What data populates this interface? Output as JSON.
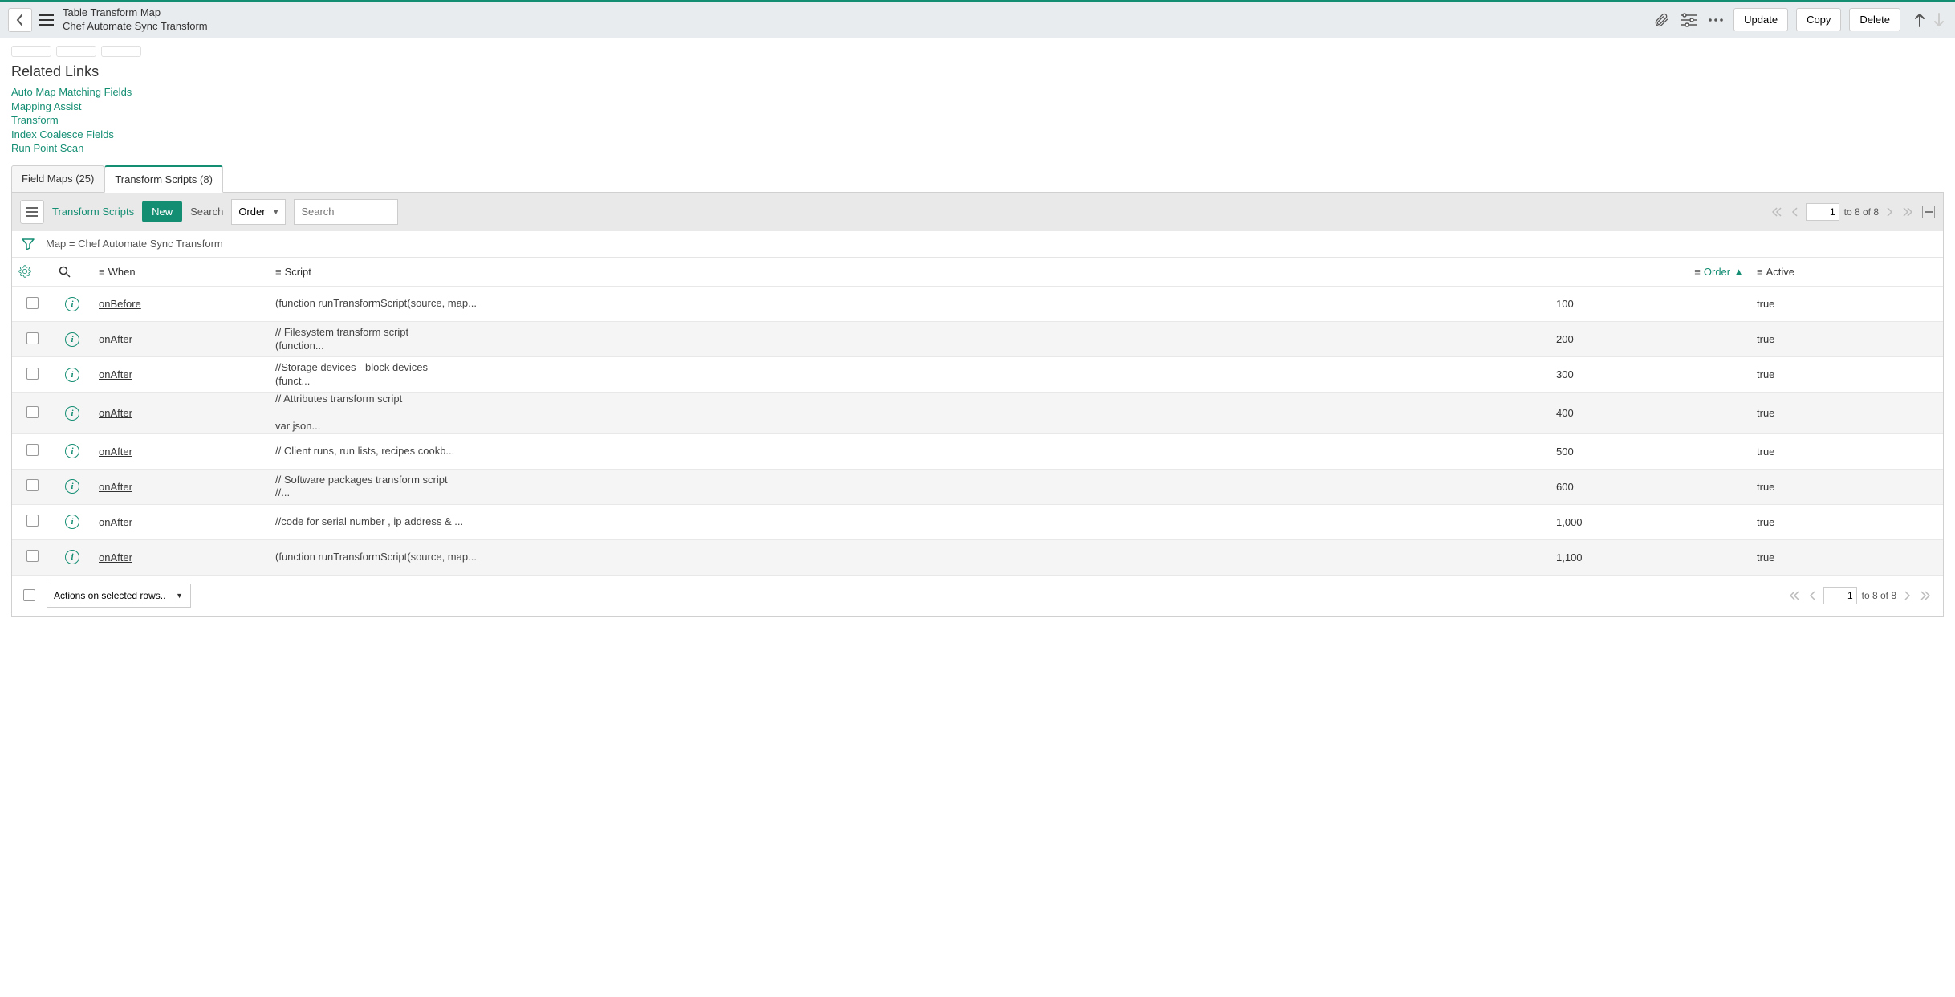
{
  "header": {
    "title": "Table Transform Map",
    "subtitle": "Chef Automate Sync Transform",
    "update_label": "Update",
    "copy_label": "Copy",
    "delete_label": "Delete"
  },
  "related": {
    "title": "Related Links",
    "links": [
      "Auto Map Matching Fields",
      "Mapping Assist",
      "Transform",
      "Index Coalesce Fields",
      "Run Point Scan"
    ]
  },
  "tabs": [
    {
      "label": "Field Maps (25)",
      "active": false
    },
    {
      "label": "Transform Scripts (8)",
      "active": true
    }
  ],
  "toolbar": {
    "list_name": "Transform Scripts",
    "new_label": "New",
    "search_label": "Search",
    "search_field": "Order",
    "search_placeholder": "Search",
    "page_current": "1",
    "page_info": "to 8 of 8"
  },
  "filter": {
    "text": "Map = Chef Automate Sync Transform"
  },
  "columns": {
    "when": "When",
    "script": "Script",
    "order": "Order",
    "active": "Active"
  },
  "rows": [
    {
      "when": "onBefore",
      "script": "(function runTransformScript(source, map...",
      "order": "100",
      "active": "true"
    },
    {
      "when": "onAfter",
      "script": "// Filesystem transform script\n(function...",
      "order": "200",
      "active": "true"
    },
    {
      "when": "onAfter",
      "script": "//Storage devices - block devices\n(funct...",
      "order": "300",
      "active": "true"
    },
    {
      "when": "onAfter",
      "script": "// Attributes transform script\n\nvar json...",
      "order": "400",
      "active": "true"
    },
    {
      "when": "onAfter",
      "script": "// Client runs, run lists, recipes cookb...",
      "order": "500",
      "active": "true"
    },
    {
      "when": "onAfter",
      "script": "// Software packages transform script\n//...",
      "order": "600",
      "active": "true"
    },
    {
      "when": "onAfter",
      "script": "//code for serial number , ip address & ...",
      "order": "1,000",
      "active": "true"
    },
    {
      "when": "onAfter",
      "script": "(function runTransformScript(source, map...",
      "order": "1,100",
      "active": "true"
    }
  ],
  "footer": {
    "actions_placeholder": "Actions on selected rows...",
    "page_current": "1",
    "page_info": "to 8 of 8"
  }
}
